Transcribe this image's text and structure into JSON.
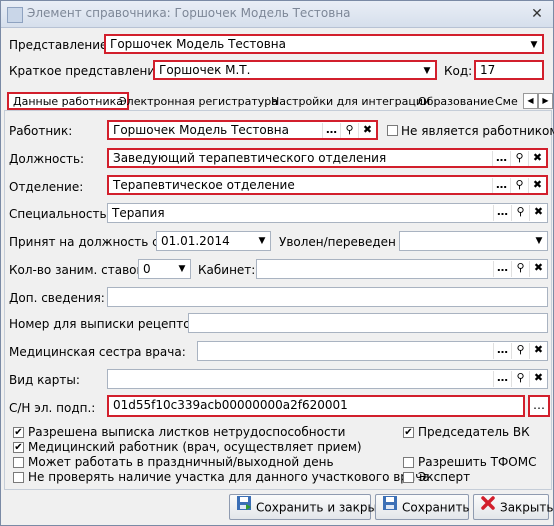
{
  "window": {
    "title": "Элемент справочника: Горшочек Модель Тестовна"
  },
  "header": {
    "view_label": "Представление:",
    "view_value": "Горшочек Модель Тестовна",
    "short_label": "Краткое представление:",
    "short_value": "Горшочек М.Т.",
    "code_label": "Код:",
    "code_value": "17"
  },
  "tabs": [
    {
      "label": "Данные работника"
    },
    {
      "label": "Электронная регистратура"
    },
    {
      "label": "Настройки для интеграции"
    },
    {
      "label": "Образование"
    },
    {
      "label": "Сме"
    }
  ],
  "form": {
    "worker_label": "Работник:",
    "worker_value": "Горшочек Модель Тестовна",
    "not_worker_label": "Не является работником",
    "position_label": "Должность:",
    "position_value": "Заведующий терапевтического отделения",
    "department_label": "Отделение:",
    "department_value": "Терапевтическое отделение",
    "specialty_label": "Специальность:",
    "specialty_value": "Терапия",
    "hired_label": "Принят на должность с:",
    "hired_value": "01.01.2014",
    "fired_label": "Уволен/переведен",
    "fired_value": "",
    "rates_label": "Кол-во заним. ставок:",
    "rates_value": "0",
    "cabinet_label": "Кабинет:",
    "cabinet_value": "",
    "extra_label": "Доп. сведения:",
    "extra_value": "",
    "recipe_label": "Номер для выписки рецептов:",
    "recipe_value": "",
    "nurse_label": "Медицинская сестра врача:",
    "nurse_value": "",
    "card_label": "Вид карты:",
    "card_value": "",
    "sn_label": "С/Н эл. подп.:",
    "sn_value": "01d55f10c339acb00000000a2f620001"
  },
  "checkboxes": [
    {
      "label": "Разрешена выписка листков нетрудоспособности",
      "checked": true
    },
    {
      "label": "Медицинский работник (врач, осуществляет прием)",
      "checked": true
    },
    {
      "label": "Может работать в праздничный/выходной день",
      "checked": false
    },
    {
      "label": "Не проверять наличие участка для данного участкового врача",
      "checked": false
    },
    {
      "label": "Председатель ВК",
      "checked": true
    },
    {
      "label": "Разрешить ТФОМС",
      "checked": false
    },
    {
      "label": "Эксперт",
      "checked": false
    }
  ],
  "buttons": {
    "save_close": "Сохранить и закрыть",
    "save": "Сохранить",
    "close": "Закрыть"
  },
  "colors": {
    "highlight": "#d21f2c",
    "title_text": "#7d8797"
  }
}
